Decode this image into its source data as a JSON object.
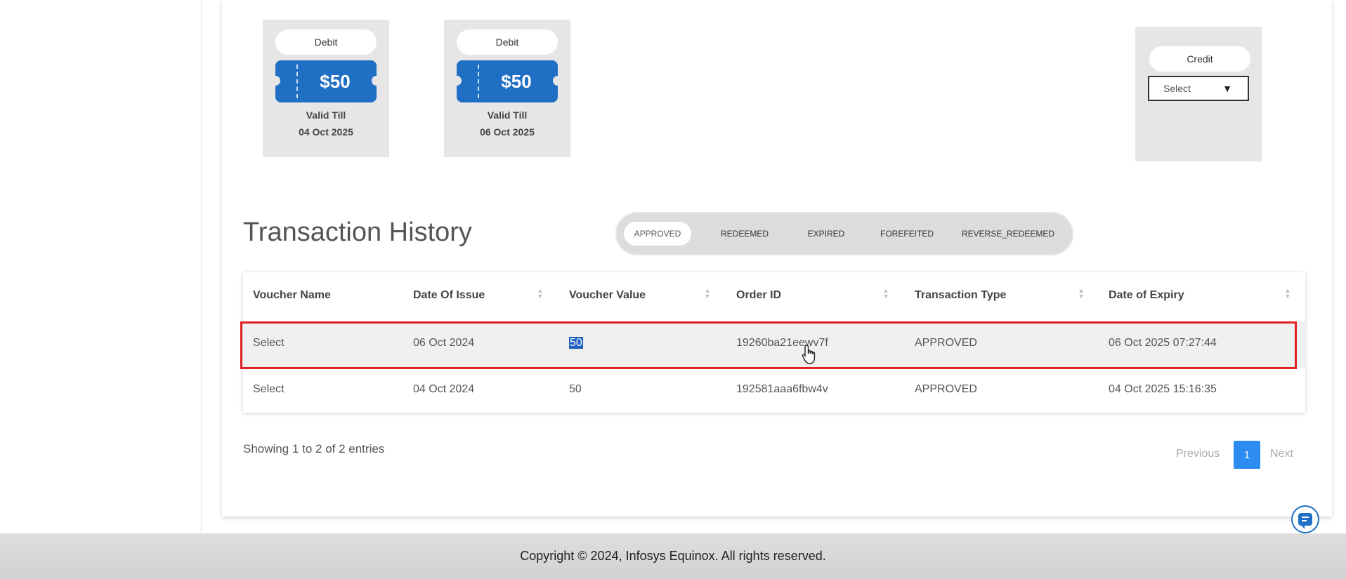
{
  "vouchers": [
    {
      "type": "Debit",
      "amount": "$50",
      "valid_label": "Valid Till",
      "valid_date": "04 Oct 2025"
    },
    {
      "type": "Debit",
      "amount": "$50",
      "valid_label": "Valid Till",
      "valid_date": "06 Oct 2025"
    }
  ],
  "credit": {
    "type": "Credit",
    "select_value": "Select"
  },
  "transaction_history": {
    "title": "Transaction History",
    "filters": [
      "APPROVED",
      "REDEEMED",
      "EXPIRED",
      "FOREFEITED",
      "REVERSE_REDEEMED"
    ],
    "active_filter": "APPROVED",
    "columns": [
      "Voucher Name",
      "Date Of Issue",
      "Voucher Value",
      "Order ID",
      "Transaction Type",
      "Date of Expiry"
    ],
    "rows": [
      {
        "voucher_name": "Select",
        "date_of_issue": "06 Oct 2024",
        "voucher_value": "50",
        "order_id": "19260ba21eewv7f",
        "transaction_type": "APPROVED",
        "date_of_expiry": "06 Oct 2025 07:27:44"
      },
      {
        "voucher_name": "Select",
        "date_of_issue": "04 Oct 2024",
        "voucher_value": "50",
        "order_id": "192581aaa6fbw4v",
        "transaction_type": "APPROVED",
        "date_of_expiry": "04 Oct 2025 15:16:35"
      }
    ],
    "entries_text": "Showing 1 to 2 of 2 entries",
    "pagination": {
      "previous": "Previous",
      "current": "1",
      "next": "Next"
    }
  },
  "footer": {
    "copyright": "Copyright © 2024, Infosys Equinox. All rights reserved."
  },
  "colors": {
    "accent": "#1f6fc5",
    "highlight": "#e02020",
    "page_active": "#2d8cf0"
  }
}
